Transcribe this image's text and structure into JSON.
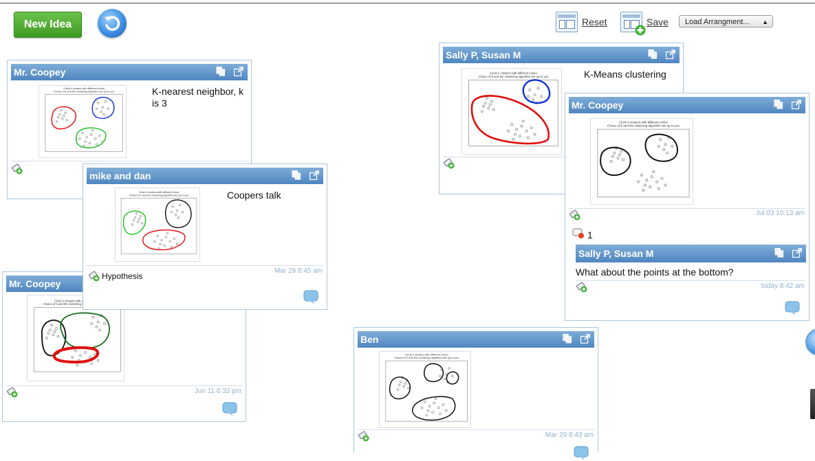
{
  "toolbar": {
    "new_idea": "New Idea",
    "reset": "Reset",
    "save": "Save",
    "load_arrangement": "Load Arrangment..."
  },
  "cards": [
    {
      "author": "Mr. Coopey",
      "text": "K-nearest neighbor, k is 3",
      "timestamp": "",
      "label": ""
    },
    {
      "author": "mike and dan",
      "text": "Coopers talk",
      "timestamp": "Mar 29 8:45 am",
      "label": "Hypothesis"
    },
    {
      "author": "Mr. Coopey",
      "text": "",
      "timestamp": "Jun 11 6:33 pm",
      "label": ""
    },
    {
      "author": "Sally P, Susan M",
      "text": "K-Means clustering",
      "timestamp": "",
      "label": ""
    },
    {
      "author": "Mr. Coopey",
      "text": "",
      "timestamp": "Jul 03 10:13 am",
      "label": "",
      "reply_count": "1",
      "reply": {
        "author": "Sally P, Susan M",
        "text": "What about the points at the bottom?",
        "timestamp": "today 8:42 am"
      }
    },
    {
      "author": "Ben",
      "text": "",
      "timestamp": "Mar 29 8:43 am",
      "label": ""
    }
  ],
  "plot": {
    "title_line1": "Circle k clusters with different colors",
    "title_line2": "Choice of k and the clustering algorithm are up to you"
  },
  "colors": {
    "accent_green": "#4caf30",
    "header_blue": "#5b8fc6",
    "cluster_red": "#e01010",
    "cluster_blue": "#1030d0",
    "cluster_green": "#20c020",
    "cluster_black": "#111111"
  },
  "icons": {
    "copy": "copy-icon",
    "popout": "popout-icon",
    "tag": "tag-add-icon",
    "comment": "comment-bubble-icon",
    "refresh": "refresh-icon"
  }
}
